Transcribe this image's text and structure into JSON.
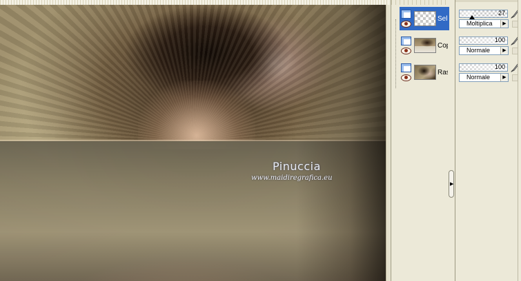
{
  "canvas": {
    "watermark_title": "Pinuccia",
    "watermark_url": "www.maidiregrafica.eu"
  },
  "layers": [
    {
      "name": "Sele",
      "thumb": "transparent",
      "selected": true,
      "opacity": "27",
      "opacity_fraction": 0.27,
      "blend_mode": "Moltiplica"
    },
    {
      "name": "Cop",
      "thumb": "copy",
      "selected": false,
      "opacity": "100",
      "opacity_fraction": 1.0,
      "blend_mode": "Normale"
    },
    {
      "name": "Ras",
      "thumb": "raster",
      "selected": false,
      "opacity": "100",
      "opacity_fraction": 1.0,
      "blend_mode": "Normale"
    }
  ],
  "icons": {
    "layer_type": "raster-layer-icon",
    "visibility": "eye-icon",
    "edit": "brush-icon",
    "lock": "lock-icon",
    "slider": "opacity-slider-icon",
    "dropdown": "chevron-right-icon",
    "collapse": "chevron-right-icon"
  },
  "colors": {
    "selection": "#316ac5",
    "panel_bg": "#ece9d8"
  }
}
